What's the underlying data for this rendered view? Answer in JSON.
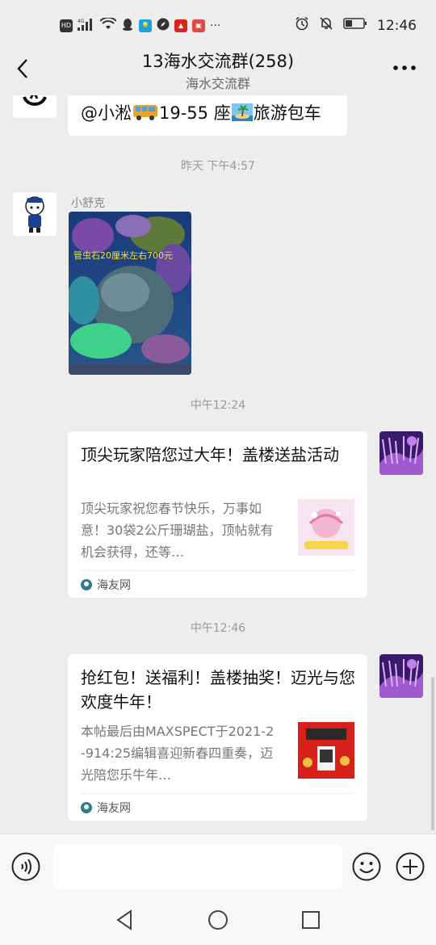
{
  "status_bar": {
    "left_icons": [
      "HD",
      "4G",
      "signal",
      "wifi",
      "qq",
      "bulb",
      "compass",
      "app-red",
      "app-box"
    ],
    "more": "···",
    "time": "12:46"
  },
  "header": {
    "title": "13海水交流群(258)",
    "subtitle": "海水交流群"
  },
  "messages": {
    "top_partial": {
      "text_a": "@小淞",
      "text_b": "19-55 座",
      "text_c": "旅游包车"
    },
    "time_1": "昨天 下午4:57",
    "m1": {
      "sender": "小舒克",
      "image_caption": "管虫石20厘米左右700元"
    },
    "time_2": "中午12:24",
    "card1": {
      "title": "顶尖玩家陪您过大年！盖楼送盐活动",
      "desc": "顶尖玩家祝您春节快乐，万事如意！30袋2公斤珊瑚盐，顶帖就有机会获得，还等…",
      "source": "海友网"
    },
    "time_3": "中午12:46",
    "card2": {
      "title": "抢红包！送福利！盖楼抽奖！迈光与您欢度牛年！",
      "desc": "本帖最后由MAXSPECT于2021-2-914:25编辑喜迎新春四重奏，迈光陪您乐牛年…",
      "source": "海友网"
    }
  },
  "input": {
    "placeholder": ""
  },
  "colors": {
    "background": "#ededed",
    "bubble": "#ffffff",
    "link_icon": "#2f7d8c"
  }
}
